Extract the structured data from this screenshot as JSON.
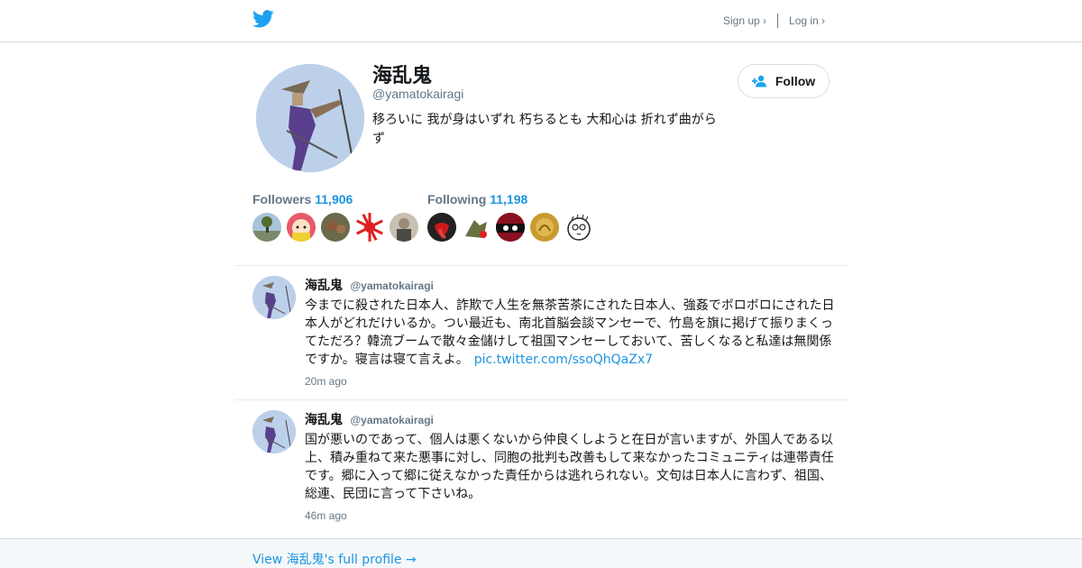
{
  "header": {
    "logo_icon": "twitter-bird-icon",
    "signup_label": "Sign up ›",
    "login_label": "Log in ›"
  },
  "profile": {
    "display_name": "海乱鬼",
    "handle": "@yamatokairagi",
    "bio": "移ろいに 我が身はいずれ 朽ちるとも 大和心は 折れず曲がらず",
    "follow_label": "Follow",
    "follow_icon": "add-user-icon"
  },
  "stats": {
    "followers_label": "Followers",
    "followers_count": "11,906",
    "following_label": "Following",
    "following_count": "11,198"
  },
  "tweets": [
    {
      "name": "海乱鬼",
      "handle": "@yamatokairagi",
      "text": "今までに殺された日本人、詐欺で人生を無茶苦茶にされた日本人、強姦でボロボロにされた日本人がどれだけいるか。つい最近も、南北首脳会談マンセーで、竹島を旗に掲げて振りまくってただろ？韓流ブームで散々金儲けして祖国マンセーしておいて、苦しくなると私達は無関係ですか。寝言は寝て言えよ。",
      "link": "pic.twitter.com/ssoQhQaZx7",
      "time": "20m ago"
    },
    {
      "name": "海乱鬼",
      "handle": "@yamatokairagi",
      "text": "国が悪いのであって、個人は悪くないから仲良くしようと在日が言いますが、外国人である以上、積み重ねて来た悪事に対し、同胞の批判も改善もして来なかったコミュニティは連帯責任です。郷に入って郷に従えなかった責任からは逃れられない。文句は日本人に言わず、祖国、総連、民団に言って下さいね。",
      "time": "46m ago"
    }
  ],
  "footer": {
    "full_profile_link": "View 海乱鬼's full profile →"
  }
}
